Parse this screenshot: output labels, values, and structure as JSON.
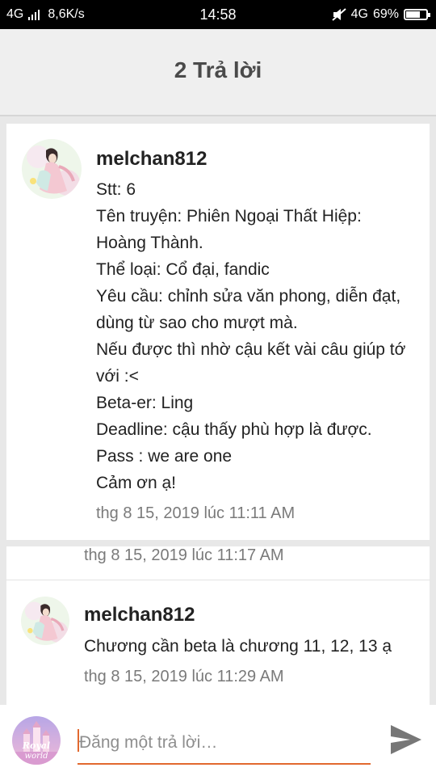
{
  "status_bar": {
    "network_left": "4G",
    "speed": "8,6K/s",
    "time": "14:58",
    "network_right": "4G",
    "battery_percent": "69%",
    "battery_level": 0.69
  },
  "header": {
    "title": "2 Trả lời"
  },
  "post": {
    "username": "melchan812",
    "lines": [
      "Stt: 6",
      "Tên truyện: Phiên Ngoại Thất Hiệp:",
      "Hoàng Thành.",
      "Thể loại: Cổ đại, fandic",
      "Yêu cầu: chỉnh sửa văn phong, diễn đạt,",
      "dùng từ sao cho mượt mà.",
      "Nếu được thì nhờ cậu kết vài câu giúp tớ",
      "với :<",
      "Beta-er: Ling",
      "Deadline: cậu thấy phù hợp là được.",
      "Pass : we are one",
      "Cảm ơn ạ!"
    ],
    "timestamp": "thg 8 15, 2019 lúc 11:11 AM"
  },
  "replies": [
    {
      "timestamp": "thg 8 15, 2019 lúc 11:17 AM"
    },
    {
      "username": "melchan812",
      "text": "Chương cần beta là chương 11, 12, 13 ạ",
      "timestamp": "thg 8 15, 2019 lúc 11:29 AM"
    }
  ],
  "composer": {
    "placeholder": "Đăng một trả lời…",
    "value": "",
    "avatar_logo_text": "Royal world",
    "send_icon": "send-icon"
  },
  "colors": {
    "accent": "#e2692f",
    "header_bg": "#efefef",
    "page_bg": "#e8e8e8"
  }
}
